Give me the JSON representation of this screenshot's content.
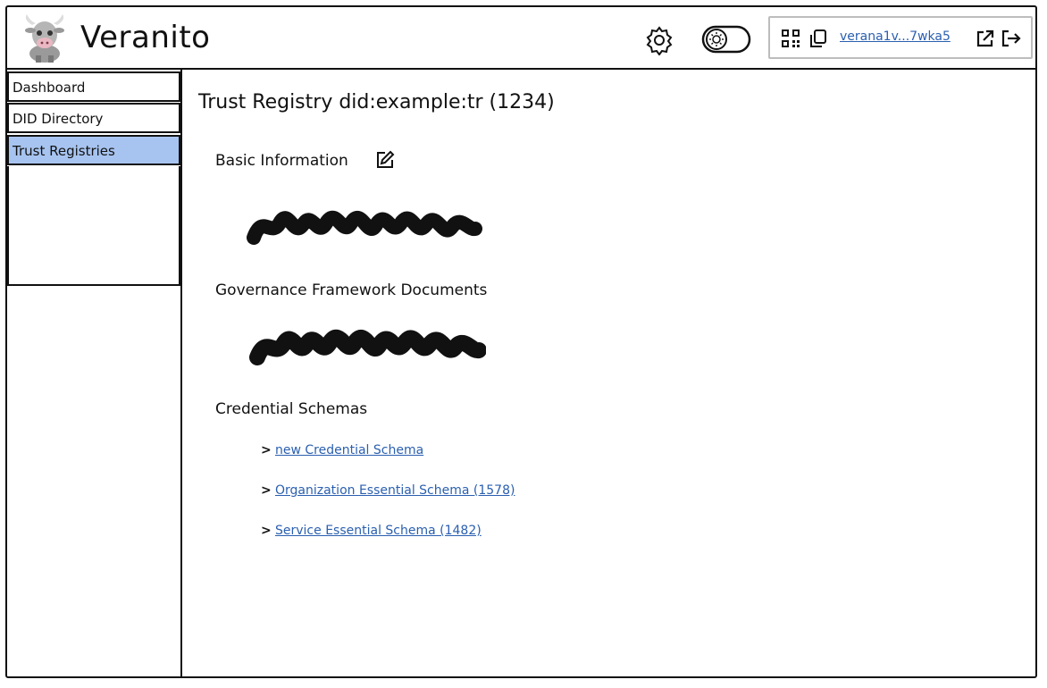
{
  "app": {
    "title": "Veranito"
  },
  "header": {
    "wallet_address": "verana1v...7wka5"
  },
  "sidebar": {
    "items": [
      {
        "label": "Dashboard",
        "active": false
      },
      {
        "label": "DID Directory",
        "active": false
      },
      {
        "label": "Trust Registries",
        "active": true
      }
    ]
  },
  "main": {
    "title": "Trust Registry did:example:tr (1234)",
    "sections": {
      "basic": "Basic Information",
      "governance": "Governance Framework Documents",
      "schemas": "Credential Schemas"
    },
    "schema_links": [
      "new Credential Schema",
      "Organization Essential Schema (1578)",
      "Service Essential Schema (1482)"
    ]
  },
  "colors": {
    "accent": "#a7c4f0",
    "link": "#2a5fb0"
  },
  "icons": [
    "gear-icon",
    "theme-toggle-icon",
    "qr-code-icon",
    "copy-icon",
    "external-link-icon",
    "logout-icon",
    "edit-icon",
    "chevron-right-icon"
  ]
}
